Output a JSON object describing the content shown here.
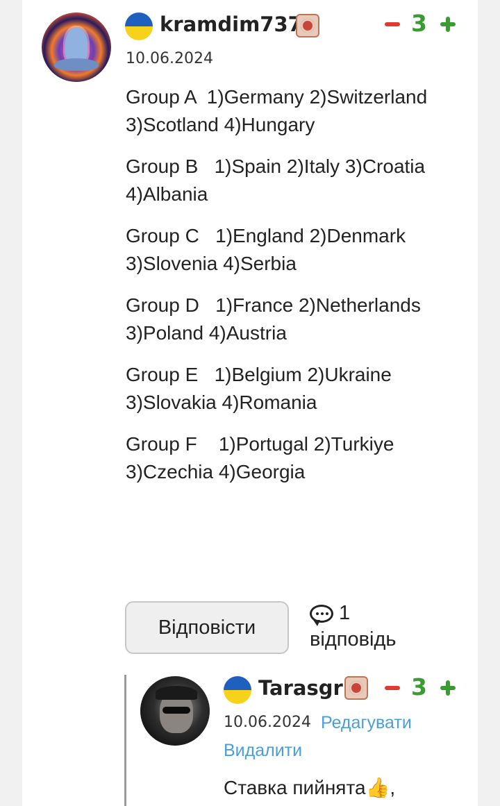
{
  "comment": {
    "username": "kramdim737",
    "date": "10.06.2024",
    "votes": "3",
    "body": [
      "Group A  1)Germany 2)Switzerland 3)Scotland 4)Hungary",
      "Group B   1)Spain 2)Italy 3)Croatia 4)Albania",
      "Group C   1)England 2)Denmark 3)Slovenia 4)Serbia",
      "Group D   1)France 2)Netherlands 3)Poland 4)Austria",
      "Group E   1)Belgium 2)Ukraine 3)Slovakia 4)Romania",
      "Group F    1)Portugal 2)Turkiye 3)Czechia 4)Georgia"
    ],
    "reply_button": "Відповісти",
    "replies_count": "1",
    "replies_label": "відповідь"
  },
  "reply": {
    "username": "Tarasgr",
    "date": "10.06.2024",
    "votes": "3",
    "edit_label": "Редагувати",
    "delete_label": "Видалити",
    "body": "Ставка пийнята👍,"
  },
  "colors": {
    "vote_up": "#3a9b32",
    "vote_down": "#e23a2f",
    "link": "#4a9fd8"
  },
  "icons": {
    "country_flag": "ukraine-flag-icon",
    "rank_badge": "rank-badge-icon",
    "replies": "speech-bubble-icon"
  }
}
